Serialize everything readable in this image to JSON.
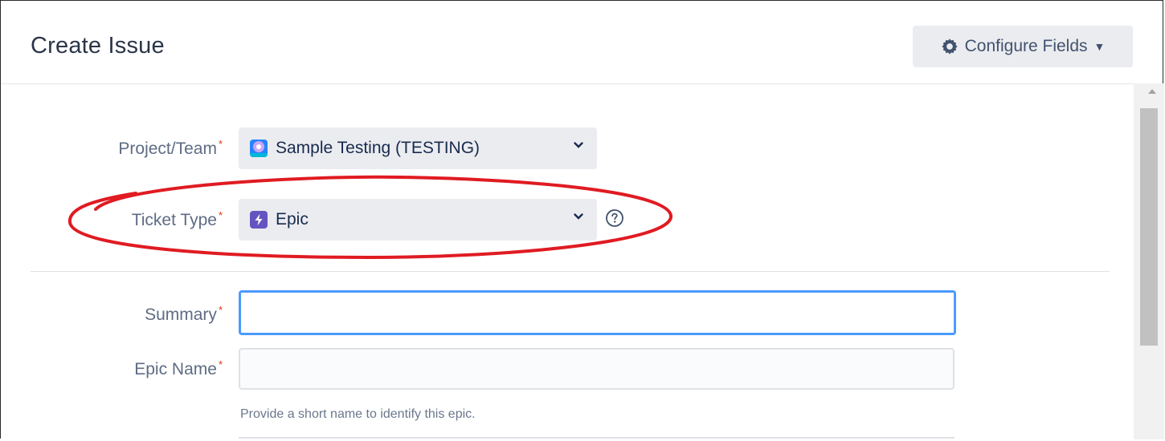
{
  "dialog": {
    "title": "Create Issue",
    "configure_fields_label": "Configure Fields"
  },
  "fields": {
    "project": {
      "label": "Project/Team",
      "required_mark": "*",
      "selected_value": "Sample Testing (TESTING)",
      "icon": "project-avatar-icon"
    },
    "ticket_type": {
      "label": "Ticket Type",
      "required_mark": "*",
      "selected_value": "Epic",
      "icon": "epic-lightning-icon",
      "help_icon": "help-circle-icon"
    },
    "summary": {
      "label": "Summary",
      "required_mark": "*",
      "value": "",
      "focused": true
    },
    "epic_name": {
      "label": "Epic Name",
      "required_mark": "*",
      "value": "",
      "hint": "Provide a short name to identify this epic."
    }
  },
  "annotation": {
    "shape": "ellipse",
    "color": "#e01b22",
    "highlights": "ticket_type"
  },
  "colors": {
    "required": "#de350b",
    "focus_border": "#4c9aff",
    "epic_purple": "#6554c0"
  }
}
